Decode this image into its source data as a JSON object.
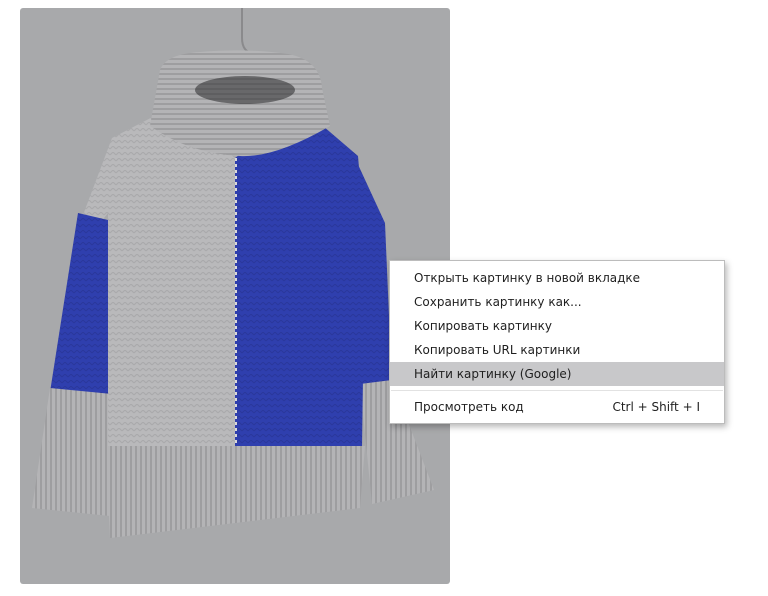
{
  "image": {
    "subject": "",
    "colors": {
      "background": "#a8a9ab",
      "knit_gray": "#b9b9bb",
      "knit_blue": "#2f3fae",
      "hanger": "#5a3a2a"
    }
  },
  "context_menu": {
    "items": [
      {
        "label": "Открыть картинку в новой вкладке",
        "shortcut": "",
        "highlighted": false
      },
      {
        "label": "Сохранить картинку как...",
        "shortcut": "",
        "highlighted": false
      },
      {
        "label": "Копировать картинку",
        "shortcut": "",
        "highlighted": false
      },
      {
        "label": "Копировать URL картинки",
        "shortcut": "",
        "highlighted": false
      },
      {
        "label": "Найти картинку (Google)",
        "shortcut": "",
        "highlighted": true
      }
    ],
    "separator_after": 4,
    "footer_item": {
      "label": "Просмотреть код",
      "shortcut": "Ctrl + Shift + I"
    }
  }
}
